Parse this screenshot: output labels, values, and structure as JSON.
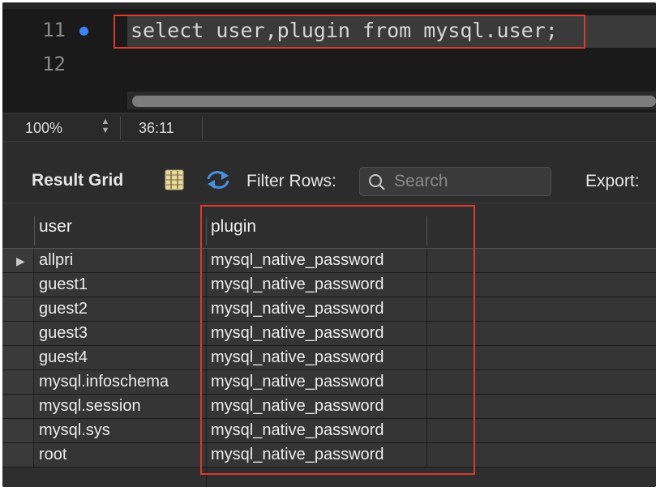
{
  "editor": {
    "lines": [
      {
        "number": "11",
        "code": "select user,plugin from mysql.user;"
      },
      {
        "number": "12",
        "code": ""
      }
    ]
  },
  "status_bar": {
    "zoom": "100%",
    "cursor_position": "36:11"
  },
  "toolbar": {
    "result_grid_label": "Result Grid",
    "filter_rows_label": "Filter Rows:",
    "search_placeholder": "Search",
    "export_label": "Export:"
  },
  "grid": {
    "columns": [
      "user",
      "plugin"
    ],
    "rows": [
      {
        "user": "allpri",
        "plugin": "mysql_native_password"
      },
      {
        "user": "guest1",
        "plugin": "mysql_native_password"
      },
      {
        "user": "guest2",
        "plugin": "mysql_native_password"
      },
      {
        "user": "guest3",
        "plugin": "mysql_native_password"
      },
      {
        "user": "guest4",
        "plugin": "mysql_native_password"
      },
      {
        "user": "mysql.infoschema",
        "plugin": "mysql_native_password"
      },
      {
        "user": "mysql.session",
        "plugin": "mysql_native_password"
      },
      {
        "user": "mysql.sys",
        "plugin": "mysql_native_password"
      },
      {
        "user": "root",
        "plugin": "mysql_native_password"
      }
    ],
    "selected_row_marker": "▶"
  },
  "colors": {
    "highlight_box": "#d9392e",
    "breakpoint_dot": "#3b82f6"
  },
  "icons": {
    "grid_view": "grid-view-icon",
    "refresh": "refresh-icon",
    "search": "search-icon",
    "zoom_stepper": "chevron-updown-icon"
  }
}
